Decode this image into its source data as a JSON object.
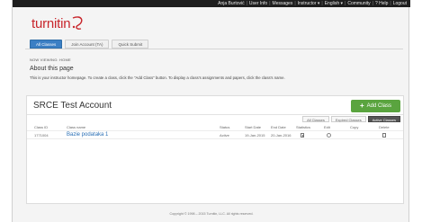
{
  "topnav": {
    "user": "Anja Burtović",
    "user_info": "User Info",
    "messages": "Messages",
    "role": "Instructor ▾",
    "language": "English ▾",
    "community": "Community",
    "help": "? Help",
    "logout": "Logout"
  },
  "brand": {
    "logo_text": "turnitin"
  },
  "tabs": [
    "All Classes",
    "Join Account (TA)",
    "Quick Submit"
  ],
  "viewing": "NOW VIEWING: HOME",
  "about": {
    "title": "About this page",
    "text": "This is your instructor homepage. To create a class, click the \"Add Class\" button. To display a class's assignments and papers, click the class's name."
  },
  "panel": {
    "title": "SRCE Test Account",
    "add_class_label": "Add Class",
    "filters": [
      "All Classes",
      "Expired Classes",
      "Active Classes"
    ]
  },
  "table": {
    "headers": {
      "class_id": "Class ID",
      "class_name": "Class name",
      "status": "Status",
      "start_date": "Start Date",
      "end_date": "End Date",
      "statistics": "Statistics",
      "edit": "Edit",
      "copy": "Copy",
      "delete": "Delete"
    },
    "rows": [
      {
        "class_id": "1771004",
        "class_name": "Bazie podataka 1",
        "status": "Active",
        "start_date": "19-Jan-2015",
        "end_date": "20-Jan-2016"
      }
    ]
  },
  "footer": "Copyright © 1998 – 2015 Turnitin, LLC. All rights reserved.",
  "colors": {
    "brand_red": "#c8262c",
    "active_tab": "#3b7fc4",
    "add_button": "#5aa43f",
    "topbar": "#1e1e1e"
  }
}
